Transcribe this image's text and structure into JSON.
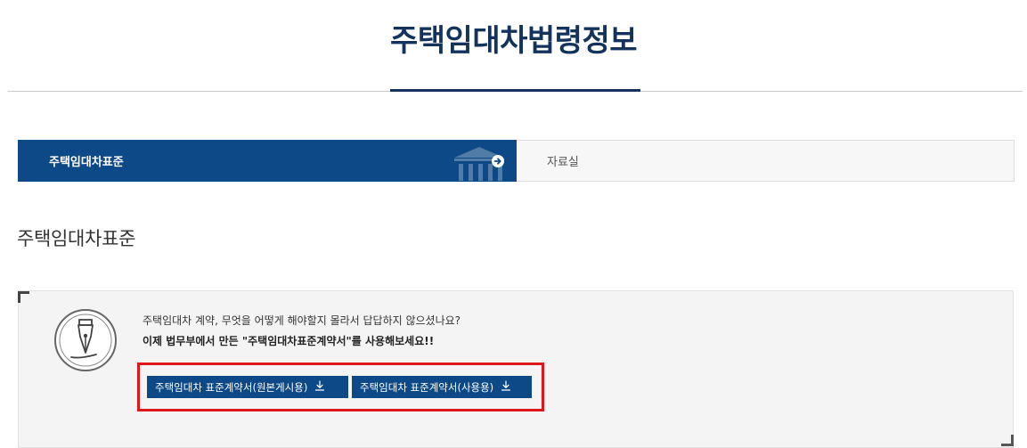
{
  "page": {
    "title": "주택임대차법령정보"
  },
  "tabs": [
    {
      "label": "주택임대차표준",
      "active": true
    },
    {
      "label": "자료실",
      "active": false
    }
  ],
  "section": {
    "title": "주택임대차표준"
  },
  "info": {
    "line1": "주택임대차 계약, 무엇을 어떻게 해야할지 몰라서 답답하지 않으셨나요?",
    "line2": "이제 법무부에서 만든 \"주택임대차표준계약서\"를 사용해보세요!!",
    "icon": "fountain-pen-icon"
  },
  "buttons": {
    "original": "주택임대차 표준계약서(원본게시용)",
    "use": "주택임대차 표준계약서(사용용)",
    "icon": "download-icon"
  },
  "colors": {
    "navy_title": "#13335d",
    "tab_active_bg": "#0e4987",
    "button_bg": "#0e4987",
    "highlight_border": "#e0161d",
    "info_bg": "#f4f4f4"
  }
}
